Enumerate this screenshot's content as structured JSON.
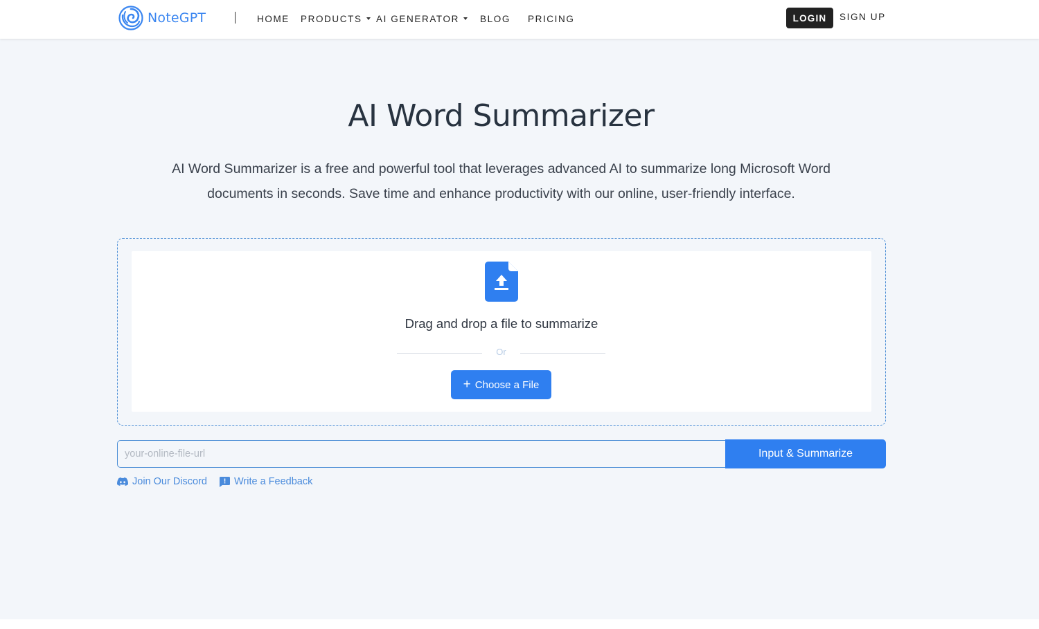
{
  "header": {
    "logo_text": "NoteGPT",
    "nav": [
      {
        "label": "HOME",
        "dropdown": false
      },
      {
        "label": "PRODUCTS",
        "dropdown": true
      },
      {
        "label": "AI GENERATOR",
        "dropdown": true
      },
      {
        "label": "BLOG",
        "dropdown": false
      },
      {
        "label": "PRICING",
        "dropdown": false
      }
    ],
    "login_label": "LOGIN",
    "signup_label": "SIGN UP"
  },
  "hero": {
    "title": "AI Word Summarizer",
    "description": "AI Word Summarizer is a free and powerful tool that leverages advanced AI to summarize long Microsoft Word documents in seconds. Save time and enhance productivity with our online, user-friendly interface."
  },
  "upload": {
    "icon": "file-upload-icon",
    "drag_text": "Drag and drop a file to summarize",
    "or_text": "Or",
    "choose_label": "Choose a File"
  },
  "url_form": {
    "placeholder": "your-online-file-url",
    "value": "",
    "submit_label": "Input & Summarize"
  },
  "links": {
    "discord_label": "Join Our Discord",
    "feedback_label": "Write a Feedback"
  },
  "colors": {
    "accent": "#2f7ff0",
    "logo": "#3b86f0",
    "link": "#4a8bdc",
    "background": "#f3f6fa",
    "dark_button": "#222222"
  }
}
